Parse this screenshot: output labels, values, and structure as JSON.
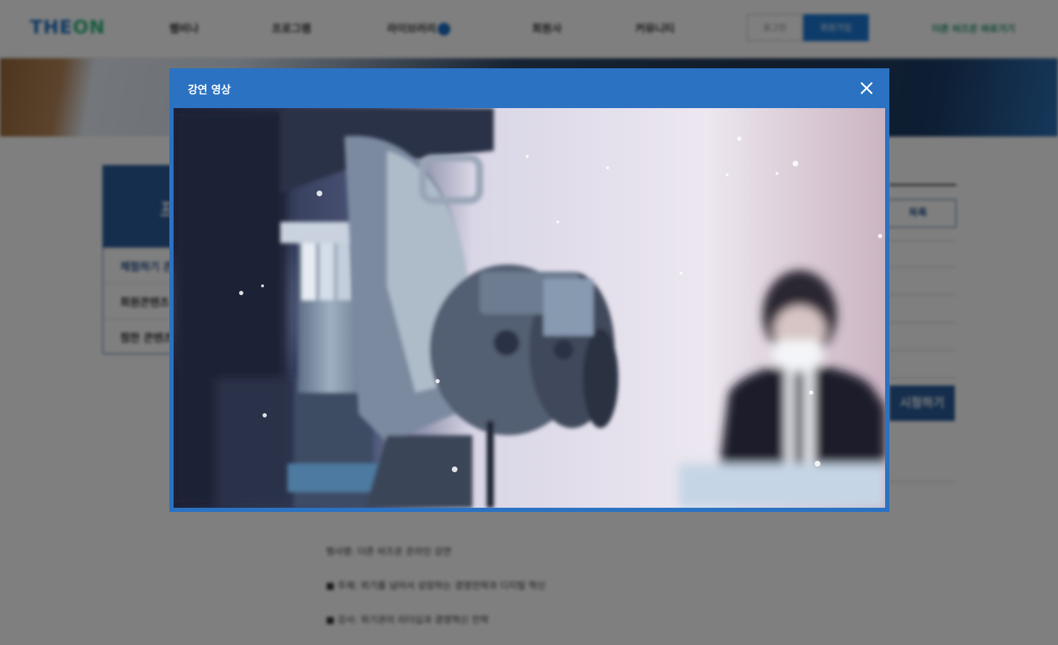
{
  "header": {
    "logo_main": "THE",
    "logo_accent": "ON",
    "nav": [
      "웹비나",
      "프로그램",
      "라이브러리",
      "회원사",
      "커뮤니티"
    ],
    "login_label": "로그인",
    "join_label": "회원가입",
    "top_right_link": "더존 비즈온 바로가기"
  },
  "sidebar": {
    "title": "프로그램",
    "items": [
      {
        "label": "체험하기 콘텐츠"
      },
      {
        "label": "회원콘텐츠"
      },
      {
        "label": "찜한 콘텐츠"
      }
    ]
  },
  "detail": {
    "list_button": "목록",
    "watch_button": "시청하기",
    "content_lines": [
      "행사명: 더존 비즈온 온라인 강연",
      "■ 주제: 위기를 넘어서 성장하는 경영전략과 디지털 혁신",
      "■ 강사: 위기관리 리더십과 경영혁신 전략"
    ]
  },
  "modal": {
    "title": "강연 영상",
    "close_icon": "close-icon"
  },
  "colors": {
    "modal_blue": "#2b72c2",
    "sidebar_blue": "#2a5d9c",
    "accent_green": "#28b87a"
  }
}
